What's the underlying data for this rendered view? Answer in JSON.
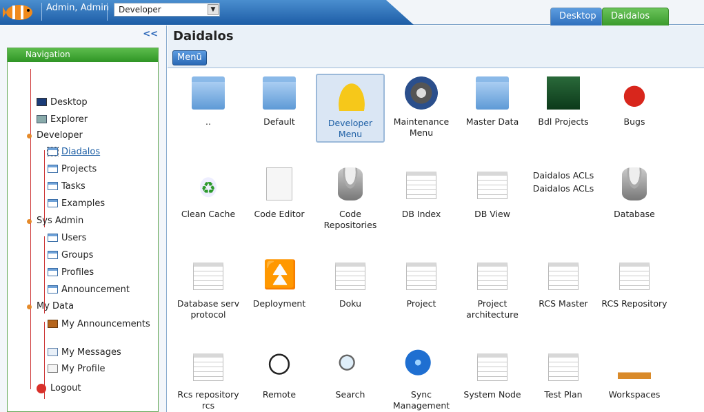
{
  "top": {
    "user": "Admin, Admin",
    "role_select": "Developer",
    "tabs": [
      "Desktop",
      "Daidalos"
    ]
  },
  "sidebar": {
    "collapse": "<<",
    "header": "Navigation",
    "items": [
      {
        "label": "Desktop",
        "icon": "monitor-icon"
      },
      {
        "label": "Explorer",
        "icon": "explorer-icon"
      },
      {
        "label": "Developer",
        "icon": "bullet"
      },
      {
        "label": "Diadalos",
        "icon": "window-icon"
      },
      {
        "label": "Projects",
        "icon": "window-icon"
      },
      {
        "label": "Tasks",
        "icon": "window-icon"
      },
      {
        "label": "Examples",
        "icon": "window-icon"
      },
      {
        "label": "Sys Admin",
        "icon": "bullet"
      },
      {
        "label": "Users",
        "icon": "window-icon"
      },
      {
        "label": "Groups",
        "icon": "window-icon"
      },
      {
        "label": "Profiles",
        "icon": "window-icon"
      },
      {
        "label": "Announcement",
        "icon": "window-icon"
      },
      {
        "label": "My Data",
        "icon": "bullet"
      },
      {
        "label": "My Announcements",
        "icon": "box-icon"
      },
      {
        "label": "My Messages",
        "icon": "mail-icon"
      },
      {
        "label": "My Profile",
        "icon": "card-icon"
      },
      {
        "label": "Logout",
        "icon": "logout-icon"
      }
    ]
  },
  "main": {
    "title": "Daidalos",
    "menu_button": "Menü",
    "tiles": [
      {
        "label": "..",
        "icon": "home-folder-icon"
      },
      {
        "label": "Default",
        "icon": "folder-icon"
      },
      {
        "label": "Developer Menu",
        "icon": "hardhat-icon"
      },
      {
        "label": "Maintenance Menu",
        "icon": "gears-icon"
      },
      {
        "label": "Master Data",
        "icon": "folder-icon"
      },
      {
        "label": "Bdl Projects",
        "icon": "fish-icon"
      },
      {
        "label": "Bugs",
        "icon": "ladybug-icon"
      },
      {
        "label": "Clean Cache",
        "icon": "recycle-icon"
      },
      {
        "label": "Code Editor",
        "icon": "document-icon"
      },
      {
        "label": "Code Repositories",
        "icon": "database-icon"
      },
      {
        "label": "DB Index",
        "icon": "sheet-icon"
      },
      {
        "label": "DB View",
        "icon": "sheet-icon"
      },
      {
        "label": "Daidalos ACLs",
        "icon": "broken-image-icon"
      },
      {
        "label": "Database",
        "icon": "database-icon"
      },
      {
        "label": "Database serv protocol",
        "icon": "sheet-icon"
      },
      {
        "label": "Deployment",
        "icon": "up-arrows-icon"
      },
      {
        "label": "Doku",
        "icon": "sheet-icon"
      },
      {
        "label": "Project",
        "icon": "sheet-icon"
      },
      {
        "label": "Project architecture",
        "icon": "sheet-icon"
      },
      {
        "label": "RCS Master",
        "icon": "sheet-icon"
      },
      {
        "label": "RCS Repository",
        "icon": "sheet-icon"
      },
      {
        "label": "Rcs repository rcs",
        "icon": "sheet-icon"
      },
      {
        "label": "Remote",
        "icon": "trooper-icon"
      },
      {
        "label": "Search",
        "icon": "magnifier-icon"
      },
      {
        "label": "Sync Management",
        "icon": "globe-icon"
      },
      {
        "label": "System Node",
        "icon": "sheet-icon"
      },
      {
        "label": "Test Plan",
        "icon": "sheet-icon"
      },
      {
        "label": "Workspaces",
        "icon": "desk-lamp-icon"
      }
    ]
  }
}
